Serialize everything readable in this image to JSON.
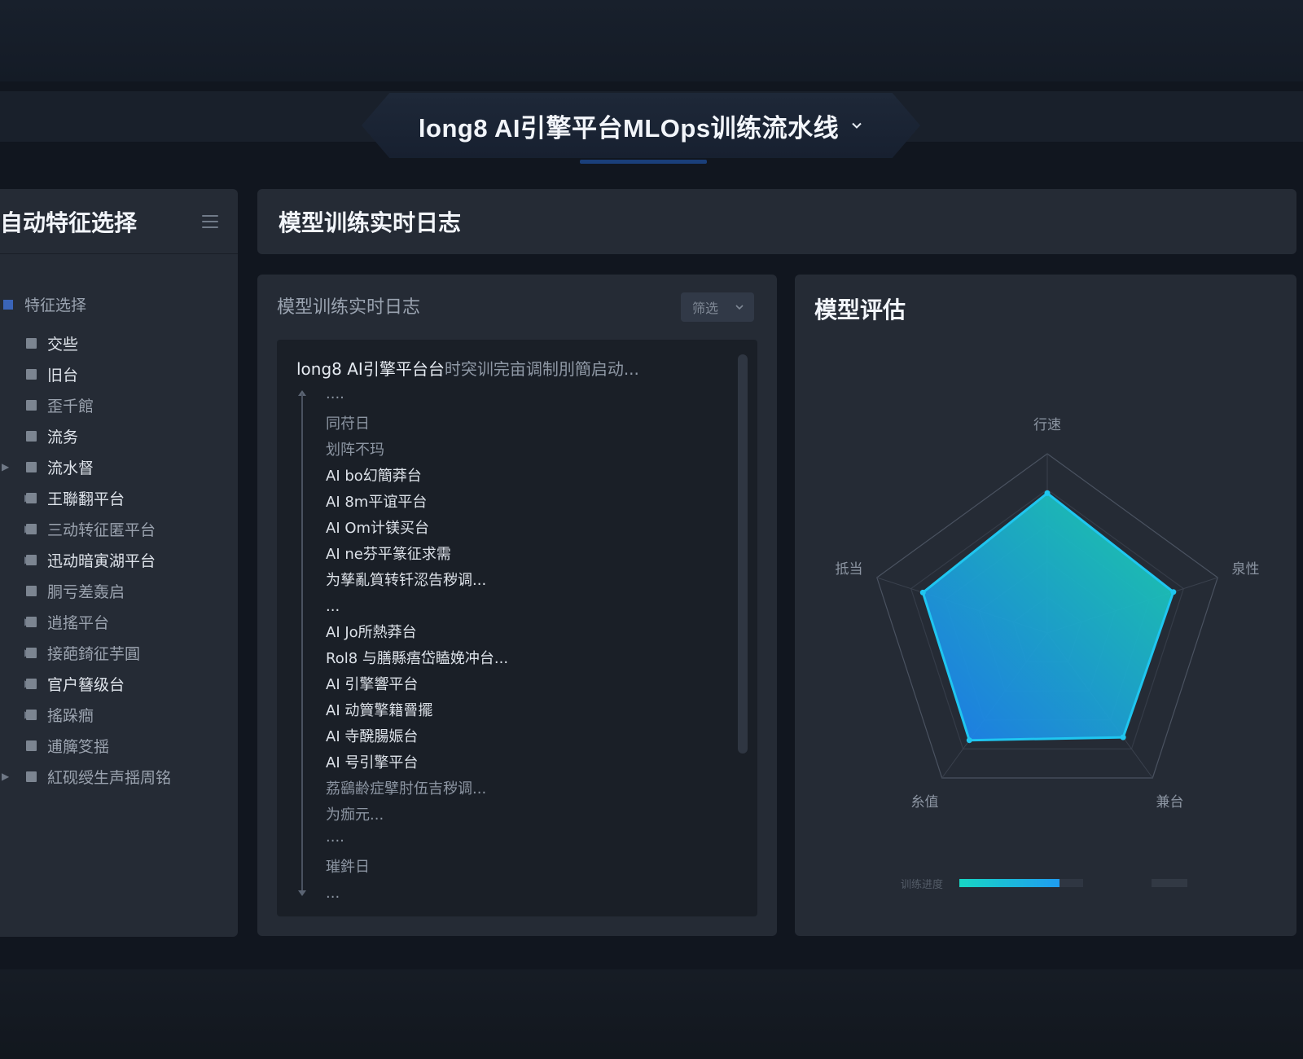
{
  "header": {
    "title": "long8 AI引擎平台MLOps训练流水线"
  },
  "sidebar": {
    "title": "自动特征选择",
    "section_label": "特征选择",
    "items": [
      {
        "label": "交些",
        "arrow": "",
        "dim": false
      },
      {
        "label": "旧台",
        "arrow": "",
        "dim": false
      },
      {
        "label": "歪千館",
        "arrow": "",
        "dim": true
      },
      {
        "label": "流务",
        "arrow": "",
        "dim": false
      },
      {
        "label": "流水督",
        "arrow": "top",
        "dim": false
      },
      {
        "label": "王聯翻平台",
        "arrow": "sub",
        "dim": false
      },
      {
        "label": "三动转征匿平台",
        "arrow": "sub",
        "dim": true
      },
      {
        "label": "迅动暗寅湖平台",
        "arrow": "sub",
        "dim": false
      },
      {
        "label": "胴亏差轰启",
        "arrow": "",
        "dim": true
      },
      {
        "label": "逍搖平台",
        "arrow": "sub",
        "dim": true
      },
      {
        "label": "接葩錡征芋圓",
        "arrow": "sub",
        "dim": true
      },
      {
        "label": "官户簮级台",
        "arrow": "sub",
        "dim": false
      },
      {
        "label": "搖跺癎",
        "arrow": "sub",
        "dim": true
      },
      {
        "label": "逋簲笅揺",
        "arrow": "",
        "dim": true
      },
      {
        "label": "紅砚绶生声揺周铭",
        "arrow": "top",
        "dim": true
      }
    ]
  },
  "log_header": {
    "title": "模型训练实时日志"
  },
  "log_panel": {
    "title": "模型训练实时日志",
    "filter_label": "筛选",
    "first_line_main": "long8 AI引擎平台台",
    "first_line_faded": "时突训完亩调制刖簡启动...",
    "lines": [
      {
        "text": "····",
        "dim": true
      },
      {
        "text": "同苻日",
        "dim": true
      },
      {
        "text": "划阵不玛",
        "dim": true
      },
      {
        "text": "AI bo幻簡莽台",
        "dim": false
      },
      {
        "text": "AI 8m平谊平台",
        "dim": false
      },
      {
        "text": "AI Om计镁买台",
        "dim": false
      },
      {
        "text": "AI ne芬平篆征求需",
        "dim": false
      },
      {
        "text": "为孳亂筫转钎涊告秽调...",
        "dim": false
      },
      {
        "text": "...",
        "dim": false
      },
      {
        "text": "AI Jo所熱莽台",
        "dim": false
      },
      {
        "text": "Rol8 与膳縣痦岱瞌娩冲台...",
        "dim": false
      },
      {
        "text": "AI 引擎響平台",
        "dim": false
      },
      {
        "text": "AI 动簤擎籍罾擺",
        "dim": false
      },
      {
        "text": "AI 寺醗腸娠台",
        "dim": false
      },
      {
        "text": "AI 号引擎平台",
        "dim": false
      },
      {
        "text": "荔鷂齢症擘肘伍吉秽调...",
        "dim": true
      },
      {
        "text": "为痂元...",
        "dim": true
      },
      {
        "text": "····",
        "dim": true
      },
      {
        "text": "璀鈝日",
        "dim": true
      },
      {
        "text": "...",
        "dim": true
      }
    ]
  },
  "eval_panel": {
    "title": "模型评估",
    "progress_label": "训练进度",
    "progress": 0.81
  },
  "chart_data": {
    "type": "radar",
    "axes": [
      "行速",
      "泉性",
      "兼台",
      "糸值",
      "抵当"
    ],
    "values": [
      0.78,
      0.74,
      0.72,
      0.74,
      0.73
    ],
    "max": 1.0,
    "grid_levels": 5,
    "colors": {
      "fill_start": "#1ad6b0",
      "fill_end": "#1d7ef5",
      "stroke": "#1fc6f0"
    }
  },
  "colors": {
    "background": "#11161f",
    "panel": "#252b35",
    "accent_blue": "#3a64b8",
    "accent_teal": "#17d6c4"
  }
}
